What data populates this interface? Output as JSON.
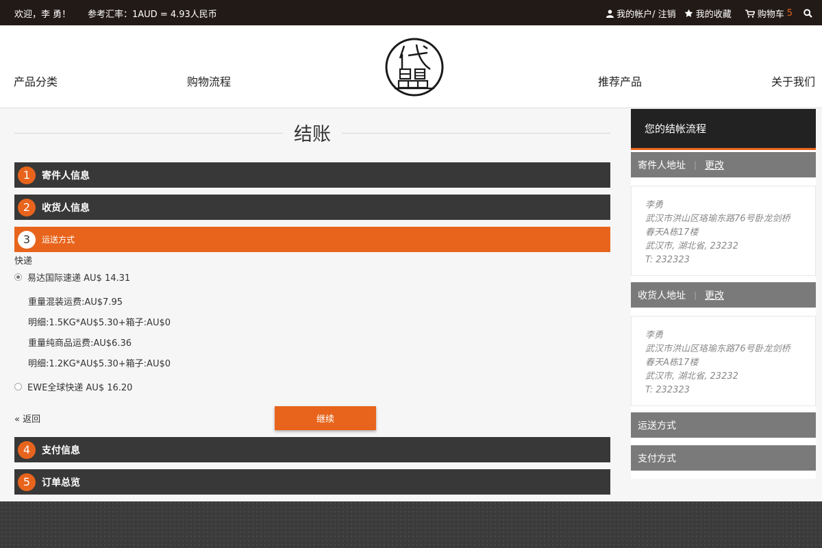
{
  "topbar": {
    "welcome": "欢迎，李 勇！",
    "exchange_rate": "参考汇率：1AUD = 4.93人民币",
    "account_link": "我的帐户/ 注销",
    "favorites_link": "我的收藏",
    "cart_label": "购物车",
    "cart_count": "5"
  },
  "nav": {
    "categories": "产品分类",
    "shopping_process": "购物流程",
    "recommended": "推荐产品",
    "about": "关于我们"
  },
  "page_title": "结账",
  "steps": [
    {
      "number": "1",
      "label": "寄件人信息"
    },
    {
      "number": "2",
      "label": "收货人信息"
    },
    {
      "number": "3",
      "label": "运送方式"
    },
    {
      "number": "4",
      "label": "支付信息"
    },
    {
      "number": "5",
      "label": "订单总览"
    }
  ],
  "shipping": {
    "group_label": "快递",
    "options": [
      {
        "label": "易达国际速递 AU$ 14.31",
        "selected": true
      },
      {
        "label": "EWE全球快递 AU$ 16.20",
        "selected": false
      }
    ],
    "details": [
      "重量混装运费:AU$7.95",
      "明细:1.5KG*AU$5.30+箱子:AU$0",
      "重量纯商品运费:AU$6.36",
      "明细:1.2KG*AU$5.30+箱子:AU$0"
    ],
    "back_label": "« 返回",
    "continue_label": "继续"
  },
  "sidebar": {
    "title": "您的结帐流程",
    "sender_section": "寄件人地址",
    "receiver_section": "收货人地址",
    "change_label": "更改",
    "separator": "|",
    "sender_address": [
      "李勇",
      "武汉市洪山区珞瑜东路76号卧龙剑桥",
      "春天A栋17楼",
      "武汉市, 湖北省, 23232",
      "T: 232323"
    ],
    "receiver_address": [
      "李勇",
      "武汉市洪山区珞瑜东路76号卧龙剑桥",
      "春天A栋17楼",
      "武汉市, 湖北省, 23232",
      "T: 232323"
    ],
    "shipping_section": "运送方式",
    "payment_section": "支付方式"
  },
  "colors": {
    "accent": "#e8641c",
    "dark": "#383838",
    "topbar": "#221a17",
    "sidebar_section": "#7a7a7a"
  }
}
